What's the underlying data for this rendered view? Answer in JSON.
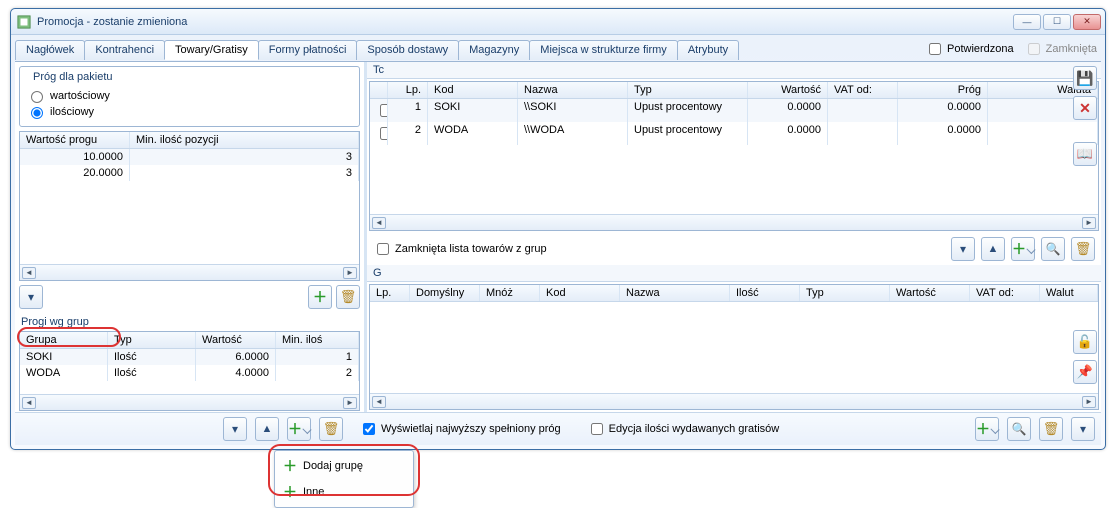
{
  "window": {
    "title": "Promocja - zostanie zmieniona"
  },
  "tabs": [
    "Nagłówek",
    "Kontrahenci",
    "Towary/Gratisy",
    "Formy płatności",
    "Sposób dostawy",
    "Magazyny",
    "Miejsca w strukturze firmy",
    "Atrybuty"
  ],
  "active_tab_index": 2,
  "header_checks": {
    "confirmed_label": "Potwierdzona",
    "closed_label": "Zamknięta"
  },
  "threshold_box": {
    "title": "Próg dla pakietu",
    "option_value": "wartościowy",
    "option_qty": "ilościowy",
    "selected": "ilościowy"
  },
  "threshold_table": {
    "columns": [
      "Wartość progu",
      "Min. ilość pozycji"
    ],
    "rows": [
      {
        "wartosc": "10.0000",
        "min": "3"
      },
      {
        "wartosc": "20.0000",
        "min": "3"
      }
    ]
  },
  "progi_title": "Progi wg grup",
  "progi_table": {
    "columns": [
      "Grupa",
      "Typ",
      "Wartość",
      "Min. iloś"
    ],
    "rows": [
      {
        "grupa": "SOKI",
        "typ": "Ilość",
        "wartosc": "6.0000",
        "min": "1"
      },
      {
        "grupa": "WODA",
        "typ": "Ilość",
        "wartosc": "4.0000",
        "min": "2"
      }
    ]
  },
  "right_top_label": "Tc",
  "towary_table": {
    "columns": [
      "Lp.",
      "Kod",
      "Nazwa",
      "Typ",
      "Wartość",
      "VAT od:",
      "Próg",
      "Waluta"
    ],
    "rows": [
      {
        "lp": "1",
        "kod": "SOKI",
        "nazwa": "\\\\SOKI",
        "typ": "Upust procentowy",
        "wartosc": "0.0000",
        "vat": "",
        "prog": "0.0000",
        "waluta": ""
      },
      {
        "lp": "2",
        "kod": "WODA",
        "nazwa": "\\\\WODA",
        "typ": "Upust procentowy",
        "wartosc": "0.0000",
        "vat": "",
        "prog": "0.0000",
        "waluta": ""
      }
    ]
  },
  "closed_list_label": "Zamknięta lista towarów z grup",
  "right_mid_label": "G",
  "gratisy_table": {
    "columns": [
      "Lp.",
      "Domyślny",
      "Mnóż",
      "Kod",
      "Nazwa",
      "Ilość",
      "Typ",
      "Wartość",
      "VAT od:",
      "Walut"
    ]
  },
  "bottom": {
    "show_highest_label": "Wyświetlaj najwyższy spełniony próg",
    "edit_qty_label": "Edycja ilości wydawanych gratisów"
  },
  "popup": {
    "item_group": "Dodaj grupę",
    "item_other": "Inne"
  }
}
